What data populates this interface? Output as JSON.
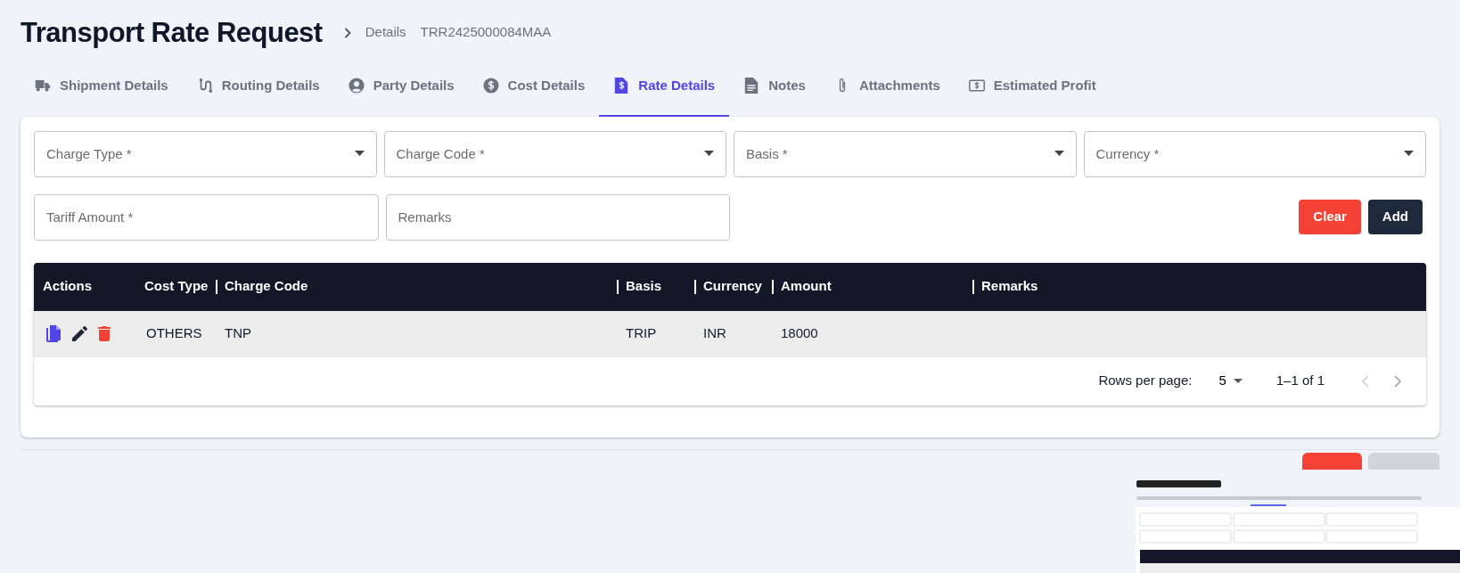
{
  "header": {
    "title": "Transport Rate Request",
    "breadcrumb": [
      {
        "label": "Details"
      },
      {
        "label": "TRR2425000084MAA"
      }
    ]
  },
  "tabs": [
    {
      "label": "Shipment Details",
      "selected": false
    },
    {
      "label": "Routing Details",
      "selected": false
    },
    {
      "label": "Party Details",
      "selected": false
    },
    {
      "label": "Cost Details",
      "selected": false
    },
    {
      "label": "Rate Details",
      "selected": true
    },
    {
      "label": "Notes",
      "selected": false
    },
    {
      "label": "Attachments",
      "selected": false
    },
    {
      "label": "Estimated Profit",
      "selected": false
    }
  ],
  "form": {
    "fields": [
      {
        "placeholder": "Charge Type *",
        "kind": "select"
      },
      {
        "placeholder": "Charge Code *",
        "kind": "select"
      },
      {
        "placeholder": "Basis *",
        "kind": "select"
      },
      {
        "placeholder": "Currency *",
        "kind": "select"
      },
      {
        "placeholder": "Tariff Amount *",
        "kind": "text"
      },
      {
        "placeholder": "Remarks",
        "kind": "text"
      }
    ],
    "buttons": [
      {
        "label": "Clear",
        "kind": "danger"
      },
      {
        "label": "Add",
        "kind": "dark"
      }
    ]
  },
  "table": {
    "columns": [
      "Actions",
      "Cost Type",
      "Charge Code",
      "Basis",
      "Currency",
      "Amount",
      "Remarks"
    ],
    "rows": [
      {
        "cost_type": "OTHERS",
        "charge_code": "TNP",
        "basis": "TRIP",
        "currency": "INR",
        "amount": "18000"
      }
    ]
  },
  "pagination": {
    "rows_per_page_label": "Rows per page:",
    "rows_per_page": "5",
    "range": "1–1 of 1",
    "prev_disabled": true,
    "next_disabled": false
  },
  "footer_buttons": [
    {
      "kind": "reset",
      "disabled": false
    },
    {
      "kind": "update",
      "disabled": true
    }
  ]
}
